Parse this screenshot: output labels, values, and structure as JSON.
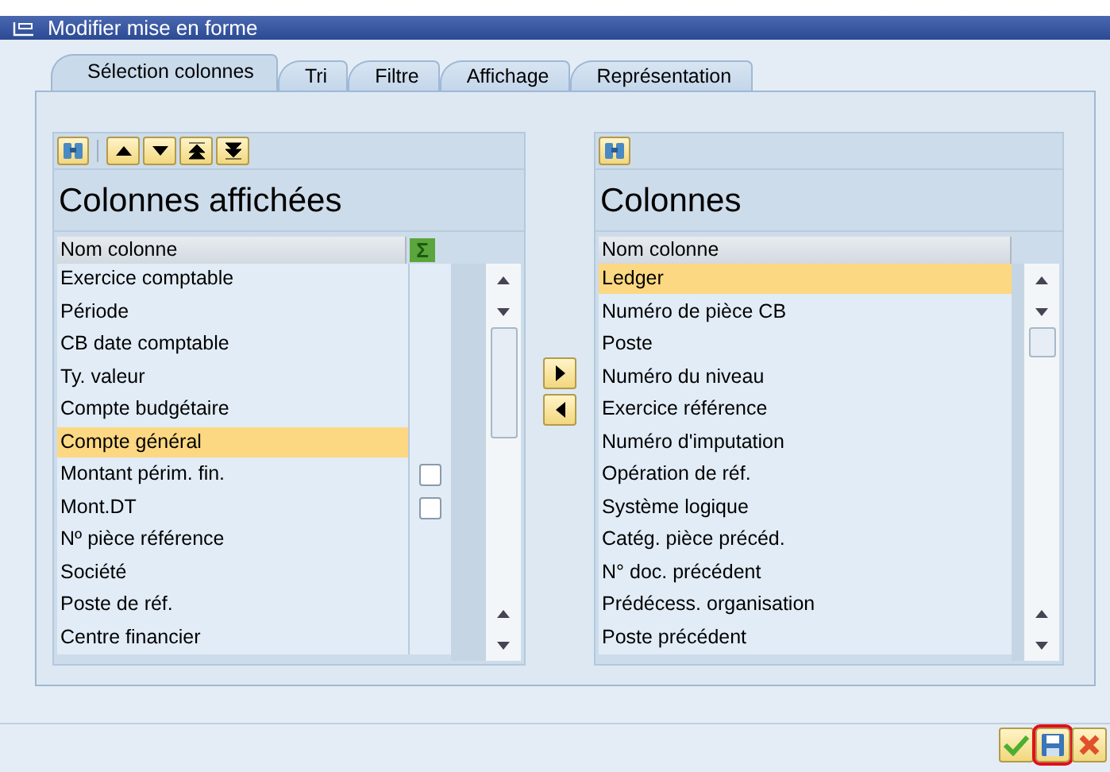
{
  "window": {
    "title": "Modifier mise en forme"
  },
  "tabs": [
    {
      "label": "Sélection colonnes",
      "selected": true
    },
    {
      "label": "Tri",
      "selected": false
    },
    {
      "label": "Filtre",
      "selected": false
    },
    {
      "label": "Affichage",
      "selected": false
    },
    {
      "label": "Représentation",
      "selected": false
    }
  ],
  "displayed_columns": {
    "title": "Colonnes affichées",
    "header": "Nom colonne",
    "sum_symbol": "Σ",
    "rows": [
      {
        "name": "Exercice comptable",
        "kind": "plain",
        "selected": false
      },
      {
        "name": "Période",
        "kind": "plain",
        "selected": false
      },
      {
        "name": "CB date comptable",
        "kind": "plain",
        "selected": false
      },
      {
        "name": "Ty. valeur",
        "kind": "plain",
        "selected": false
      },
      {
        "name": "Compte budgétaire",
        "kind": "plain",
        "selected": false
      },
      {
        "name": "Compte général",
        "kind": "plain",
        "selected": true
      },
      {
        "name": "Montant périm. fin.",
        "kind": "checkbox",
        "checked": false,
        "selected": false
      },
      {
        "name": "Mont.DT",
        "kind": "checkbox",
        "checked": false,
        "selected": false
      },
      {
        "name": "Nº pièce référence",
        "kind": "plain",
        "selected": false
      },
      {
        "name": "Société",
        "kind": "plain",
        "selected": false
      },
      {
        "name": "Poste de réf.",
        "kind": "plain",
        "selected": false
      },
      {
        "name": "Centre financier",
        "kind": "plain",
        "selected": false
      }
    ]
  },
  "available_columns": {
    "title": "Colonnes",
    "header": "Nom colonne",
    "rows": [
      {
        "name": "Ledger",
        "selected": true
      },
      {
        "name": "Numéro de pièce CB",
        "selected": false
      },
      {
        "name": "Poste",
        "selected": false
      },
      {
        "name": "Numéro du niveau",
        "selected": false
      },
      {
        "name": "Exercice référence",
        "selected": false
      },
      {
        "name": "Numéro d'imputation",
        "selected": false
      },
      {
        "name": "Opération de réf.",
        "selected": false
      },
      {
        "name": "Système logique",
        "selected": false
      },
      {
        "name": "Catég. pièce précéd.",
        "selected": false
      },
      {
        "name": "N° doc. précédent",
        "selected": false
      },
      {
        "name": "Prédécess. organisation",
        "selected": false
      },
      {
        "name": "Poste précédent",
        "selected": false
      }
    ]
  },
  "footer_buttons": [
    {
      "kind": "confirm",
      "highlighted": false
    },
    {
      "kind": "save",
      "highlighted": true
    },
    {
      "kind": "cancel",
      "highlighted": false
    }
  ]
}
